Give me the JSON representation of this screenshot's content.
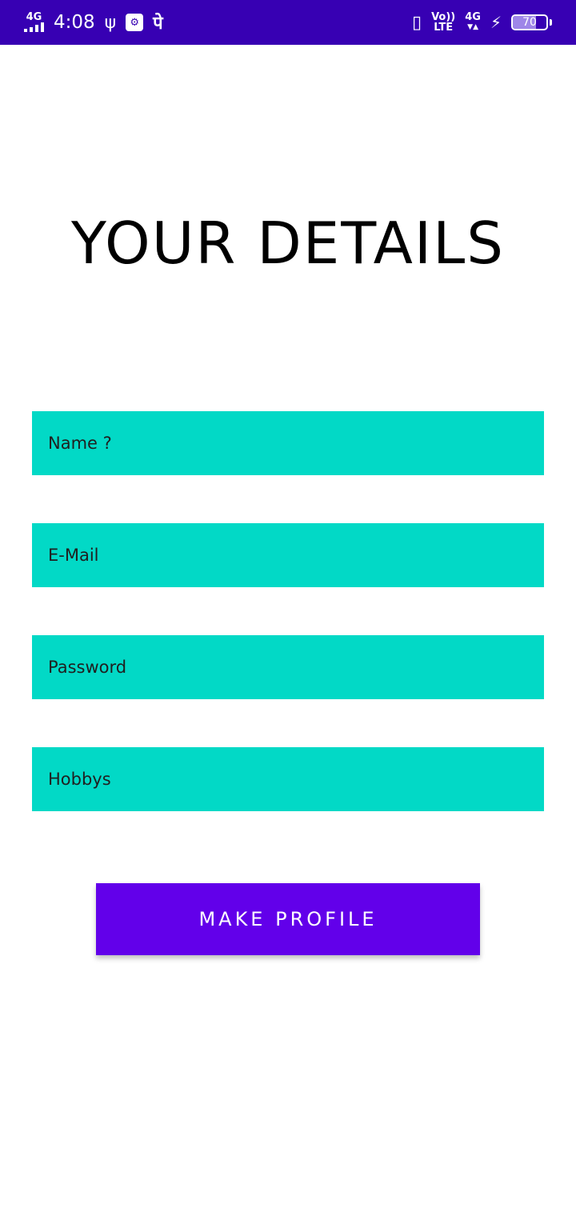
{
  "status_bar": {
    "network_left": "4G",
    "time": "4:08",
    "notif_text": "पे",
    "volte_top": "Vo))",
    "volte_bottom": "LTE",
    "network_right": "4G",
    "battery_level": "70",
    "battery_fraction": 0.7
  },
  "page": {
    "title": "YOUR DETAILS"
  },
  "form": {
    "name_placeholder": "Name ?",
    "email_placeholder": "E-Mail",
    "password_placeholder": "Password",
    "hobbys_placeholder": "Hobbys",
    "submit_label": "MAKE PROFILE"
  },
  "colors": {
    "status_bar": "#3700b3",
    "field_bg": "#02d9c6",
    "button_bg": "#6200ea"
  }
}
